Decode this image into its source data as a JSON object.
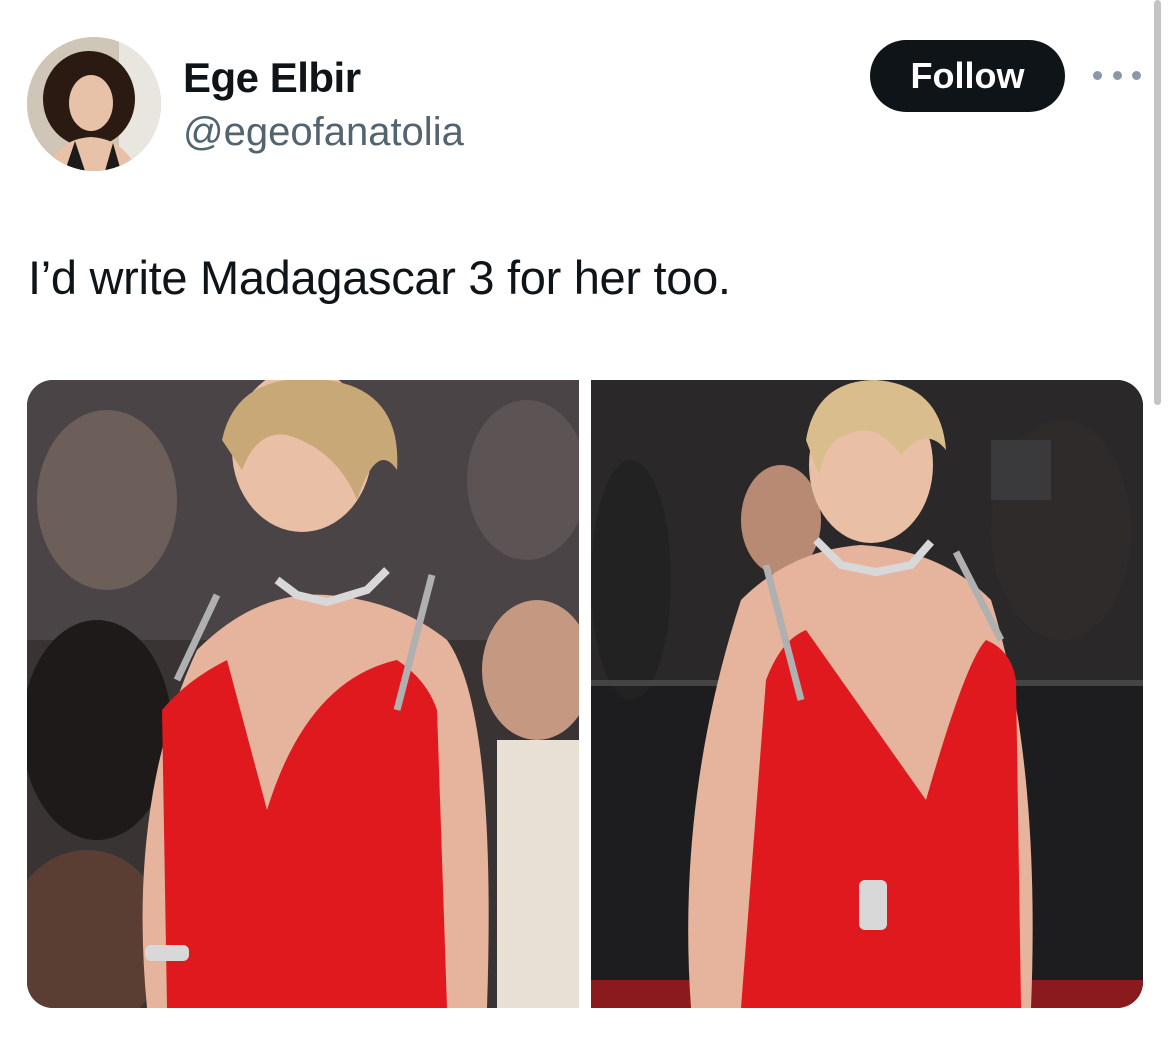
{
  "author": {
    "name": "Ege Elbir",
    "handle": "@egeofanatolia",
    "avatar_icon": "profile-avatar"
  },
  "actions": {
    "follow_label": "Follow",
    "more_icon": "more-dots-icon"
  },
  "tweet": {
    "text": "I’d write Madagascar 3 for her too."
  },
  "media": {
    "count": 2,
    "colors": {
      "dress": "#e0191f",
      "skin": "#e9b9a2",
      "hair": "#d6b98a",
      "background_dark": "#1d1d1f"
    }
  }
}
